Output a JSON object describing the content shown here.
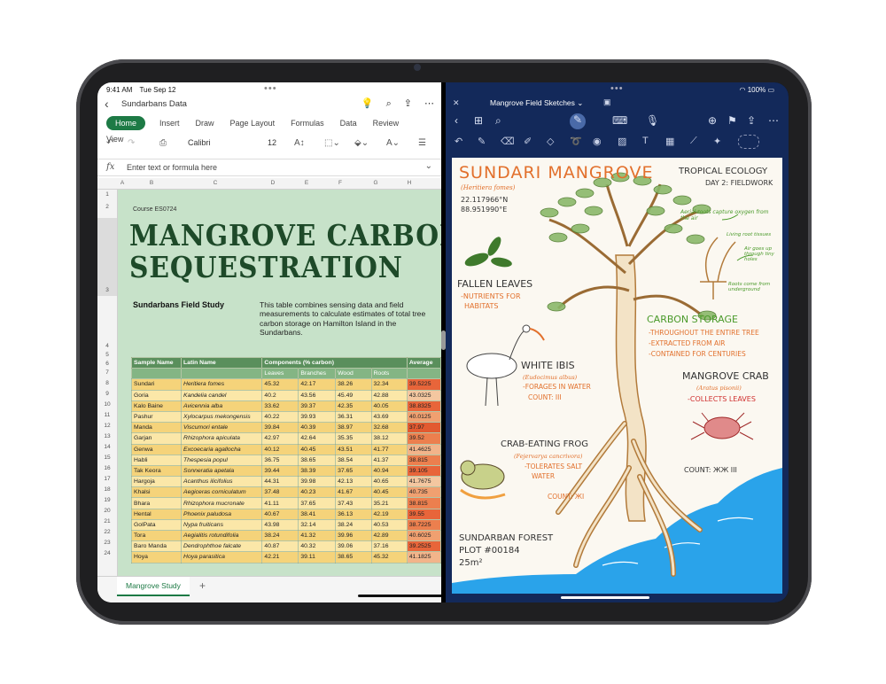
{
  "status": {
    "time": "9:41 AM",
    "date": "Tue Sep 12",
    "battery": "100%"
  },
  "excel": {
    "doc_title": "Sundarbans Data",
    "tabs": [
      "Home",
      "Insert",
      "Draw",
      "Page Layout",
      "Formulas",
      "Data",
      "Review",
      "View"
    ],
    "font_name": "Calibri",
    "font_size": "12",
    "formula_placeholder": "Enter text or formula here",
    "columns": [
      "A",
      "B",
      "C",
      "D",
      "E",
      "F",
      "G",
      "H"
    ],
    "rows": [
      "1",
      "2",
      "3",
      "4",
      "5",
      "6",
      "7",
      "8",
      "9",
      "10",
      "11",
      "12",
      "13",
      "14",
      "15",
      "16",
      "17",
      "18",
      "19",
      "20",
      "21",
      "22",
      "23",
      "24"
    ],
    "course": "Course ES0724",
    "title_line1": "MANGROVE CARBON",
    "title_line2": "SEQUESTRATION",
    "subtitle": "Sundarbans Field Study",
    "description": "This table combines sensing data and field measurements to calculate estimates of total tree carbon storage on Hamilton Island in the Sundarbans.",
    "table": {
      "header1": [
        "Sample Name",
        "Latin Name",
        "Components (% carbon)",
        "",
        "",
        "",
        "Average"
      ],
      "header2": [
        "",
        "",
        "Leaves",
        "Branches",
        "Wood",
        "Roots",
        ""
      ],
      "rows": [
        {
          "name": "Sundari",
          "latin": "Heritiera fomes",
          "v": [
            "45.32",
            "42.17",
            "38.26",
            "32.34"
          ],
          "avg": "39.5225",
          "heat": "#e8653a"
        },
        {
          "name": "Goria",
          "latin": "Kandelia candel",
          "v": [
            "40.2",
            "43.56",
            "45.49",
            "42.88"
          ],
          "avg": "43.0325",
          "heat": "#f4c7a0"
        },
        {
          "name": "Kalo Baine",
          "latin": "Avicennia alba",
          "v": [
            "33.62",
            "39.37",
            "42.35",
            "40.05"
          ],
          "avg": "38.8325",
          "heat": "#e8653a"
        },
        {
          "name": "Pashur",
          "latin": "Xylocarpus mekongensis",
          "v": [
            "40.22",
            "39.93",
            "36.31",
            "43.69"
          ],
          "avg": "40.0125",
          "heat": "#f0a070"
        },
        {
          "name": "Manda",
          "latin": "Viscumori entale",
          "v": [
            "39.84",
            "40.39",
            "38.97",
            "32.68"
          ],
          "avg": "37.97",
          "heat": "#e25a30"
        },
        {
          "name": "Garjan",
          "latin": "Rhizophora apiculata",
          "v": [
            "42.97",
            "42.64",
            "35.35",
            "38.12"
          ],
          "avg": "39.52",
          "heat": "#ec7f4e"
        },
        {
          "name": "Genwa",
          "latin": "Excoecaria agallocha",
          "v": [
            "40.12",
            "40.45",
            "43.51",
            "41.77"
          ],
          "avg": "41.4625",
          "heat": "#f2b48a"
        },
        {
          "name": "Habli",
          "latin": "Thespesia popul",
          "v": [
            "36.75",
            "38.65",
            "38.54",
            "41.37"
          ],
          "avg": "38.815",
          "heat": "#ec7f4e"
        },
        {
          "name": "Tak Keora",
          "latin": "Sonneratia apetala",
          "v": [
            "39.44",
            "38.39",
            "37.65",
            "40.94"
          ],
          "avg": "39.105",
          "heat": "#e8653a"
        },
        {
          "name": "Hargoja",
          "latin": "Acanthus ilicifolius",
          "v": [
            "44.31",
            "39.98",
            "42.13",
            "40.65"
          ],
          "avg": "41.7675",
          "heat": "#f4c7a0"
        },
        {
          "name": "Khalsi",
          "latin": "Aegiceras corniculatum",
          "v": [
            "37.48",
            "40.23",
            "41.67",
            "40.45"
          ],
          "avg": "40.735",
          "heat": "#f0a070"
        },
        {
          "name": "Bhara",
          "latin": "Rhizophora mucronate",
          "v": [
            "41.11",
            "37.65",
            "37.43",
            "35.21"
          ],
          "avg": "38.815",
          "heat": "#ec7f4e"
        },
        {
          "name": "Hental",
          "latin": "Phoenix paludosa",
          "v": [
            "40.67",
            "38.41",
            "36.13",
            "42.19"
          ],
          "avg": "39.55",
          "heat": "#e8653a"
        },
        {
          "name": "GolPata",
          "latin": "Nypa fruiticans",
          "v": [
            "43.98",
            "32.14",
            "38.24",
            "40.53"
          ],
          "avg": "38.7225",
          "heat": "#ec7f4e"
        },
        {
          "name": "Tora",
          "latin": "Aegialitis rotundifolia",
          "v": [
            "38.24",
            "41.32",
            "39.96",
            "42.89"
          ],
          "avg": "40.6025",
          "heat": "#f0a070"
        },
        {
          "name": "Baro Manda",
          "latin": "Dendrophthoe falcate",
          "v": [
            "40.87",
            "40.32",
            "39.06",
            "37.16"
          ],
          "avg": "39.2525",
          "heat": "#e8653a"
        },
        {
          "name": "Hoya",
          "latin": "Hoya parasitica",
          "v": [
            "42.21",
            "39.11",
            "38.65",
            "45.32"
          ],
          "avg": "41.1825",
          "heat": "#f2b48a"
        }
      ]
    },
    "sheet_tab": "Mangrove Study",
    "add_sheet": "+"
  },
  "notes": {
    "close": "✕",
    "doc_title": "Mangrove Field Sketches ⌄",
    "title": "SUNDARI MANGROVE",
    "latin": "(Heritiera fomes)",
    "coords1": "22.117966°N",
    "coords2": "88.951990°E",
    "course": "TROPICAL ECOLOGY",
    "day": "DAY 2: FIELDWORK",
    "aerial": "Aerial roots capture oxygen from the air",
    "living": "Living root tissues",
    "air_goes": "Air goes up through tiny holes",
    "roots_come": "Roots come from underground",
    "fallen": "FALLEN LEAVES",
    "fallen_sub1": "-NUTRIENTS FOR",
    "fallen_sub2": "HABITATS",
    "carbon": "CARBON STORAGE",
    "carbon1": "-THROUGHOUT THE ENTIRE TREE",
    "carbon2": "-EXTRACTED FROM AIR",
    "carbon3": "-CONTAINED FOR CENTURIES",
    "ibis": "WHITE IBIS",
    "ibis_latin": "(Eudocimus albus)",
    "ibis1": "-FORAGES IN WATER",
    "ibis2": "COUNT: III",
    "crab": "MANGROVE CRAB",
    "crab_latin": "(Aratus pisonii)",
    "crab1": "-COLLECTS LEAVES",
    "crab_count": "COUNT: ЖЖ III",
    "frog": "CRAB-EATING FROG",
    "frog_latin": "(Fejervarya cancrivora)",
    "frog1": "-TOLERATES SALT",
    "frog2": "WATER",
    "frog_count": "COUNT: ЖI",
    "forest1": "SUNDARBAN FOREST",
    "forest2": "PLOT #00184",
    "forest3": "25m²"
  },
  "colors": {
    "excel_green": "#1d7a45",
    "sheet_bg": "#c7e2c9",
    "notes_nav": "#13295a",
    "accent_orange": "#e2702c",
    "accent_green": "#4a9a2a"
  }
}
